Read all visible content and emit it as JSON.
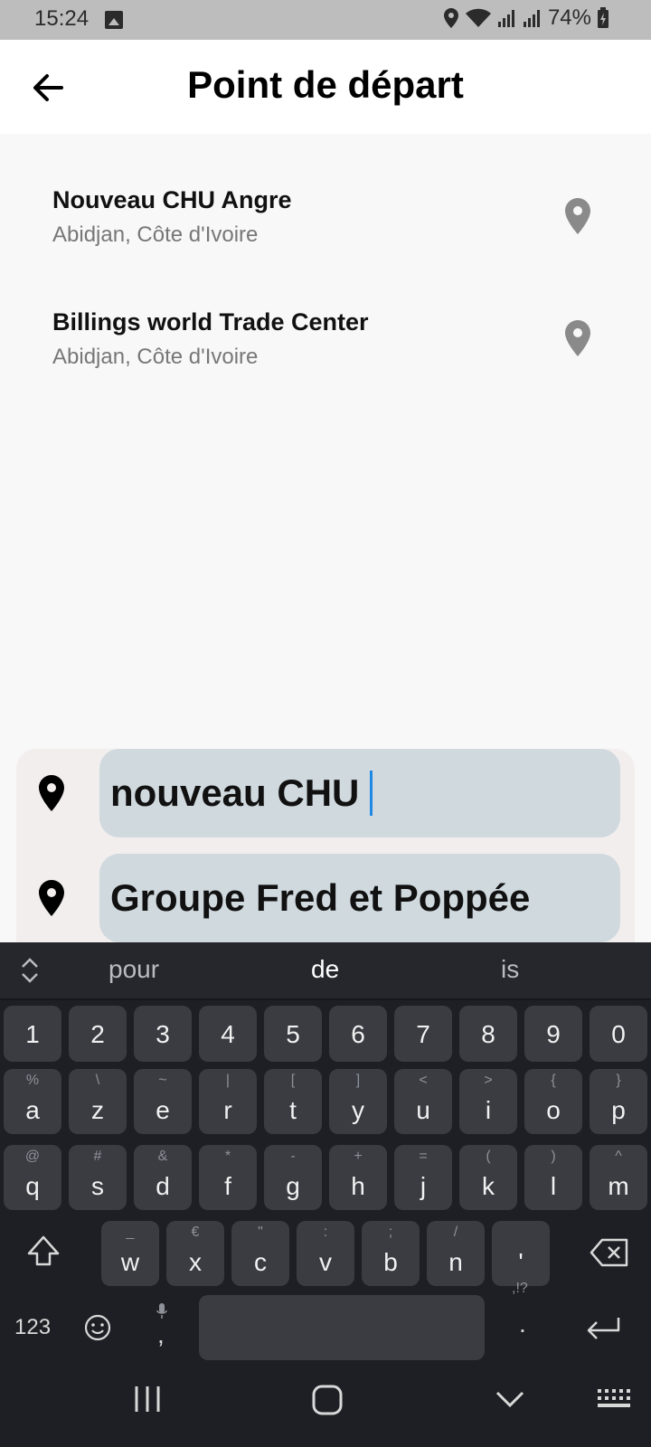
{
  "status_bar": {
    "time": "15:24",
    "battery_percent": "74%"
  },
  "header": {
    "title": "Point de départ"
  },
  "results": [
    {
      "name": "Nouveau CHU Angre",
      "location": "Abidjan, Côte d'Ivoire"
    },
    {
      "name": "Billings world Trade Center",
      "location": "Abidjan, Côte d'Ivoire"
    }
  ],
  "inputs": {
    "start_value": "nouveau CHU",
    "destination_value": "Groupe Fred et Poppée"
  },
  "keyboard": {
    "suggestions": [
      "pour",
      "de",
      "is"
    ],
    "number_row": [
      "1",
      "2",
      "3",
      "4",
      "5",
      "6",
      "7",
      "8",
      "9",
      "0"
    ],
    "row1": [
      {
        "main": "a",
        "alt": "%"
      },
      {
        "main": "z",
        "alt": "\\"
      },
      {
        "main": "e",
        "alt": "~"
      },
      {
        "main": "r",
        "alt": "|"
      },
      {
        "main": "t",
        "alt": "["
      },
      {
        "main": "y",
        "alt": "]"
      },
      {
        "main": "u",
        "alt": "<"
      },
      {
        "main": "i",
        "alt": ">"
      },
      {
        "main": "o",
        "alt": "{"
      },
      {
        "main": "p",
        "alt": "}"
      }
    ],
    "row2": [
      {
        "main": "q",
        "alt": "@"
      },
      {
        "main": "s",
        "alt": "#"
      },
      {
        "main": "d",
        "alt": "&"
      },
      {
        "main": "f",
        "alt": "*"
      },
      {
        "main": "g",
        "alt": "-"
      },
      {
        "main": "h",
        "alt": "+"
      },
      {
        "main": "j",
        "alt": "="
      },
      {
        "main": "k",
        "alt": "("
      },
      {
        "main": "l",
        "alt": ")"
      },
      {
        "main": "m",
        "alt": "^"
      }
    ],
    "row3": [
      {
        "main": "w",
        "alt": "_"
      },
      {
        "main": "x",
        "alt": "€"
      },
      {
        "main": "c",
        "alt": "\""
      },
      {
        "main": "v",
        "alt": ":"
      },
      {
        "main": "b",
        "alt": ";"
      },
      {
        "main": "n",
        "alt": "/"
      },
      {
        "main": "'",
        "alt": ""
      }
    ],
    "symbols_label": "123",
    "comma_label": ",",
    "period_label": ".",
    "period_alt": ",!?"
  },
  "colors": {
    "accent_caret": "#1e88e5",
    "field_bg": "#d0d9de",
    "keyboard_bg": "#1e1f24"
  }
}
